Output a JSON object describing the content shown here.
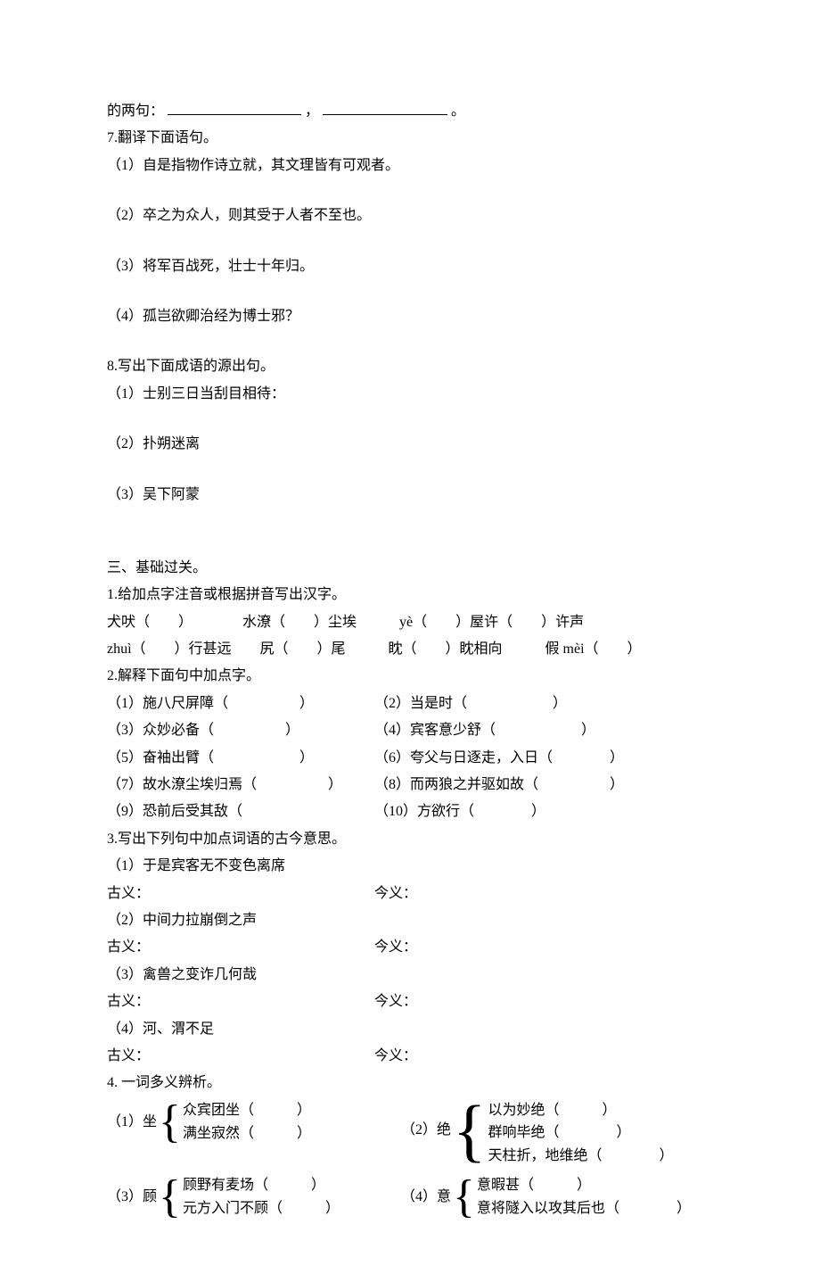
{
  "top": {
    "line1_a": "的两句：",
    "line1_comma": "，",
    "line1_period": "。",
    "q7": "7.翻译下面语句。",
    "q7_1": "（1）自是指物作诗立就，其文理皆有可观者。",
    "q7_2": "（2）卒之为众人，则其受于人者不至也。",
    "q7_3": "（3）将军百战死，壮士十年归。",
    "q7_4": "（4）孤岂欲卿治经为博士邪？",
    "q8": "8.写出下面成语的源出句。",
    "q8_1": "（1）士别三日当刮目相待：",
    "q8_2": "（2）扑朔迷离",
    "q8_3": "（3）吴下阿蒙"
  },
  "sec3": {
    "title": "三、基础过关。",
    "q1": "1.给加点字注音或根据拼音写出汉字。",
    "q1_l1": "犬吠（　　）　　　　水潦（　　）尘埃　　　yè（　　）屋许（　　）许声",
    "q1_l2": "zhuì（　　）行甚远　　尻（　　）尾　　　眈（　　）眈相向　　　假 mèi（　　）",
    "q2": "2.解释下面句中加点字。",
    "q2_1a": "（1）施八尺屏障（　　　　　）",
    "q2_1b": "（2）当是时（　　　　　　）",
    "q2_2a": "（3）众妙必备（　　　　　）",
    "q2_2b": "（4）宾客意少舒（　　　　　　）",
    "q2_3a": "（5）奋袖出臂（　　　　　　）",
    "q2_3b": "（6）夸父与日逐走，入日（　　　　）",
    "q2_4a": "（7）故水潦尘埃归焉（　　　　　）",
    "q2_4b": "（8）而两狼之并驱如故（　　　　　）",
    "q2_5a": "（9）恐前后受其敌（",
    "q2_5b": "（10）方欲行（　　　　）",
    "q3": "3.写出下列句中加点词语的古今意思。",
    "q3_1": "（1）于是宾客无不变色离席",
    "q3_2": "（2）中间力拉崩倒之声",
    "q3_3": "（3）禽兽之变诈几何哉",
    "q3_4": "（4）河、渭不足",
    "gu": "古义：",
    "jin": "今义：",
    "q4": "4. 一词多义辨析。",
    "q4_1_label": "（1）坐",
    "q4_1_a": "众宾团坐（　　　）",
    "q4_1_b": "满坐寂然（　　　）",
    "q4_2_label": "（2）绝",
    "q4_2_a": "以为妙绝（　　　）",
    "q4_2_b": "群响毕绝（　　　　）",
    "q4_2_c": "天柱折，地维绝（　　　　）",
    "q4_3_label": "（3）顾",
    "q4_3_a": "顾野有麦场（　　　）",
    "q4_3_b": "元方入门不顾（　　　）",
    "q4_4_label": "（4）意",
    "q4_4_a": "意暇甚（　　　）",
    "q4_4_b": "意将隧入以攻其后也（　　　　）"
  }
}
